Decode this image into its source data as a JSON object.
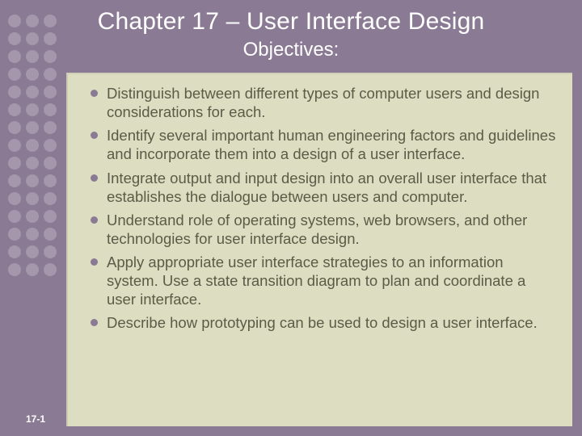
{
  "header": {
    "title": "Chapter 17 – User Interface Design",
    "subtitle": "Objectives:"
  },
  "bullets": [
    "Distinguish between different types of computer users and design considerations for each.",
    "Identify several important human engineering factors and guidelines and incorporate them into a design of a user interface.",
    "Integrate output and input design into an overall user interface that establishes the dialogue between users and computer.",
    "Understand role of operating systems, web browsers, and other technologies for user interface design.",
    "Apply appropriate user interface strategies to an information system. Use a state transition diagram to plan and coordinate a user interface.",
    "Describe how prototyping can be used to design a user interface."
  ],
  "page_number": "17-1"
}
